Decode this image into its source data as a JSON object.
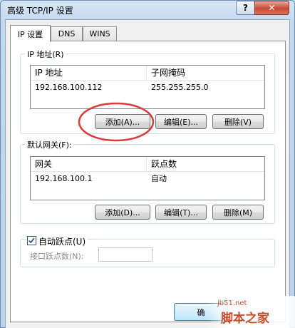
{
  "window": {
    "title": "高级 TCP/IP 设置",
    "help_label": "?",
    "close_label": "✕"
  },
  "tabs": [
    {
      "label": "IP 设置"
    },
    {
      "label": "DNS"
    },
    {
      "label": "WINS"
    }
  ],
  "ip_group": {
    "label": "IP 地址(R)",
    "columns": [
      "IP 地址",
      "子网掩码"
    ],
    "rows": [
      {
        "ip": "192.168.100.112",
        "mask": "255.255.255.0"
      }
    ],
    "buttons": {
      "add": "添加(A)...",
      "edit": "编辑(E)...",
      "delete": "删除(V)"
    }
  },
  "gateway_group": {
    "label": "默认网关(F):",
    "columns": [
      "网关",
      "跃点数"
    ],
    "rows": [
      {
        "gateway": "192.168.100.1",
        "metric": "自动"
      }
    ],
    "buttons": {
      "add": "添加(D)...",
      "edit": "编辑(T)...",
      "delete": "删除(M)"
    }
  },
  "auto_metric": {
    "label": "自动跃点(U)",
    "checked": true
  },
  "interface_metric": {
    "label": "接口跃点数(N):",
    "value": ""
  },
  "footer": {
    "ok_label": "确"
  },
  "watermark": {
    "url": "jb51.net",
    "text": "脚本之家"
  },
  "colors": {
    "accent": "#3c7fb1",
    "highlight_ellipse": "#d93a3a"
  }
}
